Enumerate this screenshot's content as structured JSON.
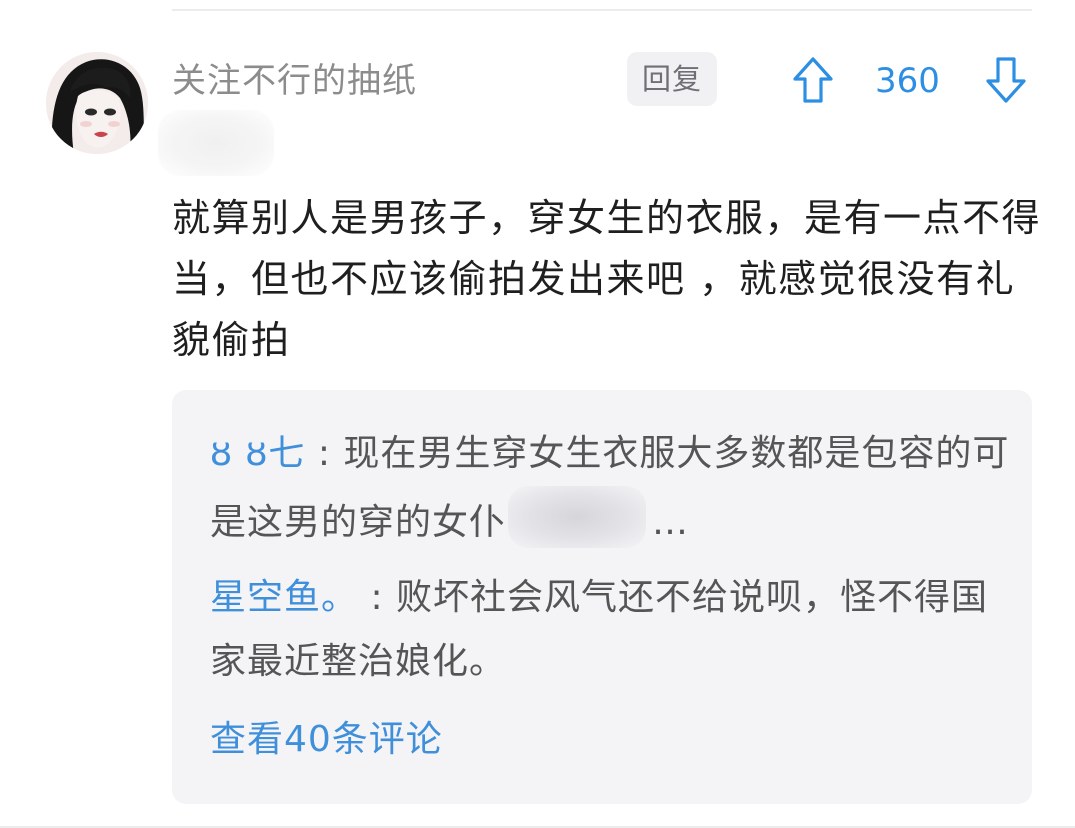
{
  "comment": {
    "username": "关注不行的抽纸",
    "reply_label": "回复",
    "vote_count": "360",
    "body": "就算别人是男孩子，穿女生的衣服，是有一点不得当，但也不应该偷拍发出来吧 ，就感觉很没有礼貌偷拍",
    "icons": {
      "avatar": "avatar",
      "upvote": "arrow-up-icon",
      "downvote": "arrow-down-icon"
    }
  },
  "replies": [
    {
      "name": "ȣ ȣ七",
      "separator": " : ",
      "text_before": "现在男生穿女生衣服大多数都是包容的可是这男的穿的女仆",
      "text_after": "…"
    },
    {
      "name": "星空鱼。",
      "separator": " : ",
      "text": "败坏社会风气还不给说呗，怪不得国家最近整治娘化。"
    }
  ],
  "view_more": "查看40条评论",
  "colors": {
    "accent": "#2d8fe3",
    "link": "#3f8fdb",
    "username": "#8c8c8c",
    "body_text": "#1f1f1f",
    "reply_text": "#555555",
    "reply_box_bg": "#f4f4f7"
  }
}
